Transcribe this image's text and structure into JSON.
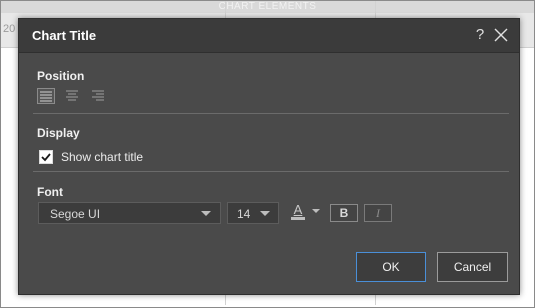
{
  "background": {
    "header_text": "CHART ELEMENTS",
    "row_cell_text": "20"
  },
  "dialog": {
    "title": "Chart Title",
    "help_label": "?",
    "sections": {
      "position": "Position",
      "display": "Display",
      "font": "Font"
    },
    "position": {
      "options": [
        "align-left",
        "align-center",
        "align-right"
      ],
      "selected": "align-left"
    },
    "display": {
      "show_title_label": "Show chart title",
      "show_title_checked": true
    },
    "font": {
      "family": "Segoe UI",
      "size": "14",
      "color_glyph": "A",
      "bold_label": "B",
      "italic_label": "I"
    },
    "buttons": {
      "ok": "OK",
      "cancel": "Cancel"
    }
  },
  "colors": {
    "dialog_bg": "#4a4a4a",
    "titlebar_bg": "#3b3b3b",
    "ok_border": "#4a8fd8"
  }
}
